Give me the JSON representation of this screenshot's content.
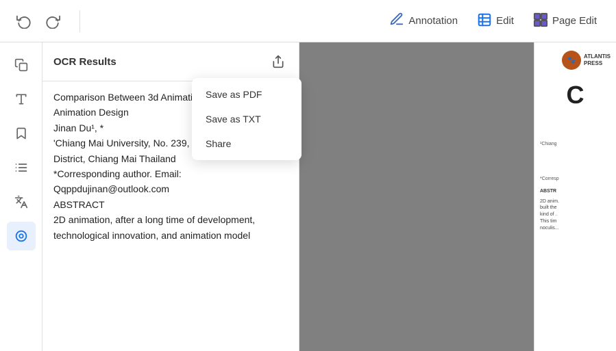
{
  "toolbar": {
    "undo_label": "↺",
    "redo_label": "↻",
    "annotation_label": "Annotation",
    "edit_label": "Edit",
    "page_edit_label": "Page Edit"
  },
  "sidebar": {
    "icons": [
      {
        "name": "copy-icon",
        "symbol": "⧉",
        "active": false
      },
      {
        "name": "text-format-icon",
        "symbol": "A≡",
        "active": false
      },
      {
        "name": "bookmark-icon",
        "symbol": "🔖",
        "active": false
      },
      {
        "name": "list-icon",
        "symbol": "☰",
        "active": false
      },
      {
        "name": "translate-icon",
        "symbol": "文",
        "active": false
      },
      {
        "name": "ocr-icon",
        "symbol": "◎",
        "active": true
      }
    ]
  },
  "ocr_panel": {
    "title": "OCR Results",
    "content": "Comparison Between 3d Animation Design and 2d Animation Design\nJinan Du¹, *\n'Chiang Mai University, No. 239, Huiqiao Road, Sudeci District, Chiang Mai Thailand\n*Corresponding author. Email: Qqppdujinan@outlook.com\nABSTRACT\n2D animation, after a long time of development, technological innovation, and animation model"
  },
  "dropdown": {
    "items": [
      {
        "label": "Save as PDF",
        "name": "save-as-pdf"
      },
      {
        "label": "Save as TXT",
        "name": "save-as-txt"
      },
      {
        "label": "Share",
        "name": "share"
      }
    ]
  },
  "pdf_preview": {
    "logo_letter": "🐾",
    "logo_name": "ATLANTIS\nPRESS",
    "large_char": "C",
    "footnote1": "¹Chiang",
    "footnote2": "*Corresp",
    "abstract_label": "ABSTR",
    "body_text": "2D anim.\nbuilt the\nkind of .\nThis tim\nnoculis..."
  }
}
